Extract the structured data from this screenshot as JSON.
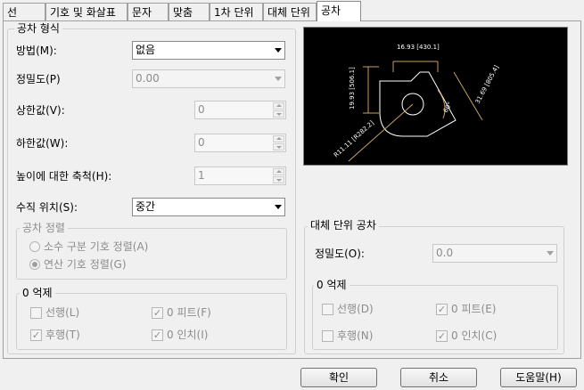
{
  "tabs": [
    "선",
    "기호 및 화살표",
    "문자",
    "맞춤",
    "1차 단위",
    "대체 단위",
    "공차"
  ],
  "tolerance_format": {
    "title": "공차 형식",
    "method_label": "방법(M):",
    "method_value": "없음",
    "precision_label": "정밀도(P)",
    "precision_value": "0.00",
    "upper_label": "상한값(V):",
    "upper_value": "0",
    "lower_label": "하한값(W):",
    "lower_value": "0",
    "height_label": "높이에 대한 축척(H):",
    "height_value": "1",
    "vpos_label": "수직 위치(S):",
    "vpos_value": "중간"
  },
  "alignment": {
    "title": "공차 정렬",
    "opt1": "소수 구분 기호 정렬(A)",
    "opt2": "연산 기호 정렬(G)"
  },
  "zero_suppress": {
    "title": "0 억제",
    "leading": "선행(L)",
    "trailing": "후행(T)",
    "feet": "0 피트(F)",
    "inches": "0 인치(I)"
  },
  "alt_units": {
    "title": "대체 단위 공차",
    "precision_label": "정밀도(O):",
    "precision_value": "0.0",
    "zero_title": "0 억제",
    "leading": "선행(D)",
    "trailing": "후행(N)",
    "feet": "0 피트(E)",
    "inches": "0 인치(C)"
  },
  "preview_labels": {
    "top": "16.93 [430.1]",
    "left": "19.93 [506.1]",
    "right": "31.69 [805.4]",
    "angle": "60°",
    "radius": "R11.11 [R282.2]"
  },
  "buttons": {
    "ok": "확인",
    "cancel": "취소",
    "help": "도움말(H)"
  },
  "colors": {
    "preview_bg": "#000000",
    "preview_lines": "#ffffff",
    "preview_dims": "#c8a060"
  }
}
